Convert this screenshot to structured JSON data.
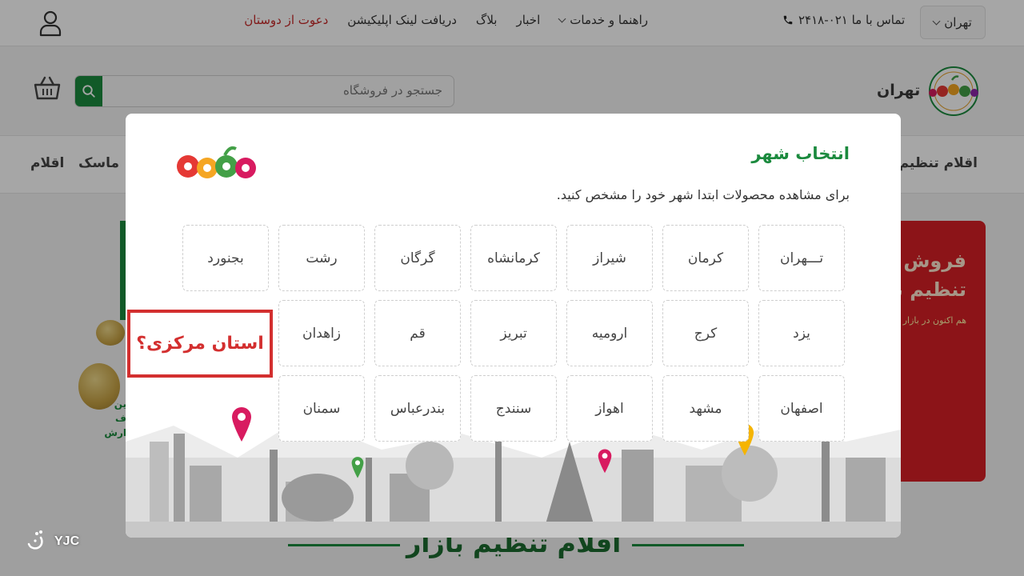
{
  "topbar": {
    "city_label": "تهران",
    "contact_label": "تماس با ما ۰۲۱-۲۴۱۸",
    "nav": {
      "guide_label": "راهنما و خدمات",
      "news_label": "اخبار",
      "blog_label": "بلاگ",
      "app_link_label": "دریافت لینک اپلیکیشن",
      "invite_label": "دعوت از دوستان"
    },
    "colors": {
      "invite": "#c62828"
    }
  },
  "header": {
    "logo_city": "تهران",
    "search_placeholder": "جستجو در فروشگاه"
  },
  "category_nav": {
    "items": [
      "اقلام تنظیم بـ",
      "ماسک",
      "اقلام"
    ]
  },
  "background": {
    "promo_line1": "فروش انو",
    "promo_line2": "تنظیم بـ",
    "promo_sub": "هم اکنون در بازار",
    "left_promo_text": "ین ف ارش",
    "bottom_section_title": "اقلام تنظیم بازار"
  },
  "modal": {
    "title": "انتخاب شهر",
    "subtitle": "برای مشاهده محصولات ابتدا شهر خود را مشخص کنید.",
    "cities": [
      [
        "تـــهران",
        "کرمان",
        "شیراز",
        "کرمانشاه",
        "گرگان",
        "رشت",
        "بجنورد"
      ],
      [
        "یزد",
        "کرج",
        "ارومیه",
        "تبریز",
        "قم",
        "زاهدان"
      ],
      [
        "اصفهان",
        "مشهد",
        "اهواز",
        "سنندج",
        "بندرعباس",
        "سمنان"
      ]
    ],
    "colors": {
      "title": "#1b8a3e"
    }
  },
  "annotation": {
    "text": "استان مرکزی؟",
    "color": "#d32f2f"
  },
  "watermark": {
    "text": "YJC"
  },
  "brand_colors": {
    "green": "#1b8a3e",
    "red": "#d71f26"
  }
}
